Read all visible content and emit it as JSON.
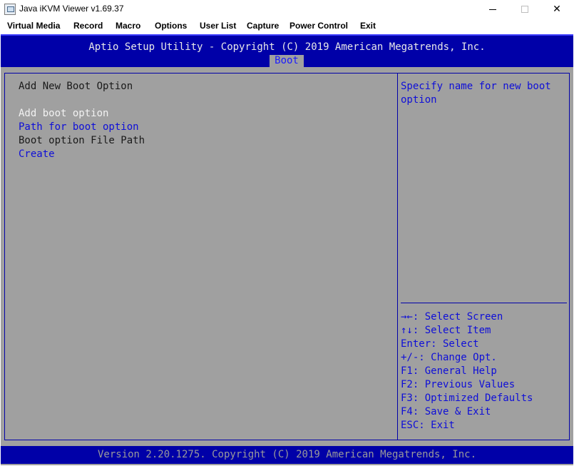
{
  "window": {
    "title": "Java iKVM Viewer v1.69.37"
  },
  "menubar": {
    "items": [
      "Virtual Media",
      "Record",
      "Macro",
      "Options",
      "User List",
      "Capture",
      "Power Control",
      "Exit"
    ]
  },
  "bios": {
    "header": "Aptio Setup Utility - Copyright (C) 2019 American Megatrends, Inc.",
    "active_tab": "Boot",
    "section_title": "Add New Boot Option",
    "items": [
      "Add boot option",
      "Path for boot option",
      "Boot option File Path",
      "Create"
    ],
    "help_text": [
      "Specify name for new boot",
      "option"
    ],
    "keys": [
      "→←: Select Screen",
      "↑↓: Select Item",
      "Enter: Select",
      "+/-: Change Opt.",
      "F1: General Help",
      "F2: Previous Values",
      "F3: Optimized Defaults",
      "F4: Save & Exit",
      "ESC: Exit"
    ],
    "footer": "Version 2.20.1275. Copyright (C) 2019 American Megatrends, Inc."
  },
  "colors": {
    "bios_blue": "#0000a8",
    "bios_gray": "#a0a0a0",
    "item_blue": "#0e0ed8",
    "item_white": "#f2f2f2"
  }
}
